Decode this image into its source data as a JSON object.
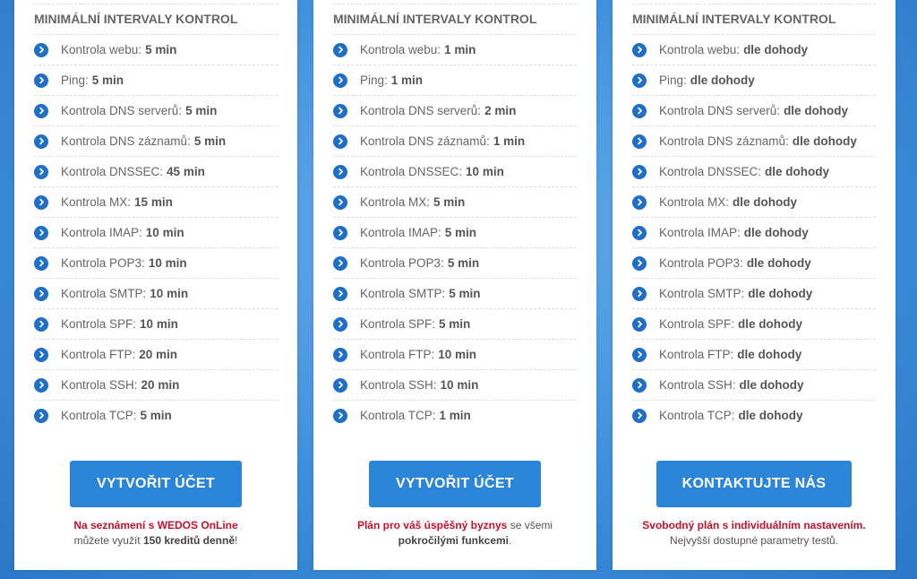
{
  "colors": {
    "accent": "#2b86d9",
    "icon": "#1f6fc9",
    "highlight": "#c8102e"
  },
  "icon_name": "chevron-right-circle-icon",
  "cards": [
    {
      "title": "MINIMÁLNÍ INTERVALY KONTROL",
      "items": [
        {
          "label": "Kontrola webu:",
          "value": "5 min"
        },
        {
          "label": "Ping:",
          "value": "5 min"
        },
        {
          "label": "Kontrola DNS serverů:",
          "value": "5 min"
        },
        {
          "label": "Kontrola DNS záznamů:",
          "value": "5 min"
        },
        {
          "label": "Kontrola DNSSEC:",
          "value": "45 min"
        },
        {
          "label": "Kontrola MX:",
          "value": "15 min"
        },
        {
          "label": "Kontrola IMAP:",
          "value": "10 min"
        },
        {
          "label": "Kontrola POP3:",
          "value": "10 min"
        },
        {
          "label": "Kontrola SMTP:",
          "value": "10 min"
        },
        {
          "label": "Kontrola SPF:",
          "value": "10 min"
        },
        {
          "label": "Kontrola FTP:",
          "value": "20 min"
        },
        {
          "label": "Kontrola SSH:",
          "value": "20 min"
        },
        {
          "label": "Kontrola TCP:",
          "value": "5 min"
        }
      ],
      "button": "VYTVOŘIT ÚČET",
      "note": {
        "line1_red": "Na seznámení s WEDOS OnLine",
        "line2_pre": "můžete využít",
        "line2_bold": "150 kreditů denně",
        "line2_post": "!"
      }
    },
    {
      "title": "MINIMÁLNÍ INTERVALY KONTROL",
      "items": [
        {
          "label": "Kontrola webu:",
          "value": "1 min"
        },
        {
          "label": "Ping:",
          "value": "1 min"
        },
        {
          "label": "Kontrola DNS serverů:",
          "value": "2 min"
        },
        {
          "label": "Kontrola DNS záznamů:",
          "value": "1 min"
        },
        {
          "label": "Kontrola DNSSEC:",
          "value": "10 min"
        },
        {
          "label": "Kontrola MX:",
          "value": "5 min"
        },
        {
          "label": "Kontrola IMAP:",
          "value": "5 min"
        },
        {
          "label": "Kontrola POP3:",
          "value": "5 min"
        },
        {
          "label": "Kontrola SMTP:",
          "value": "5 min"
        },
        {
          "label": "Kontrola SPF:",
          "value": "5 min"
        },
        {
          "label": "Kontrola FTP:",
          "value": "10 min"
        },
        {
          "label": "Kontrola SSH:",
          "value": "10 min"
        },
        {
          "label": "Kontrola TCP:",
          "value": "1 min"
        }
      ],
      "button": "VYTVOŘIT ÚČET",
      "note": {
        "line1_red": "Plán pro váš úspěšný byznys",
        "line1_post": "se všemi",
        "line2_bold": "pokročilými funkcemi",
        "line2_post": "."
      }
    },
    {
      "title": "MINIMÁLNÍ INTERVALY KONTROL",
      "items": [
        {
          "label": "Kontrola webu:",
          "value": "dle dohody"
        },
        {
          "label": "Ping:",
          "value": "dle dohody"
        },
        {
          "label": "Kontrola DNS serverů:",
          "value": "dle dohody"
        },
        {
          "label": "Kontrola DNS záznamů:",
          "value": "dle dohody"
        },
        {
          "label": "Kontrola DNSSEC:",
          "value": "dle dohody"
        },
        {
          "label": "Kontrola MX:",
          "value": "dle dohody"
        },
        {
          "label": "Kontrola IMAP:",
          "value": "dle dohody"
        },
        {
          "label": "Kontrola POP3:",
          "value": "dle dohody"
        },
        {
          "label": "Kontrola SMTP:",
          "value": "dle dohody"
        },
        {
          "label": "Kontrola SPF:",
          "value": "dle dohody"
        },
        {
          "label": "Kontrola FTP:",
          "value": "dle dohody"
        },
        {
          "label": "Kontrola SSH:",
          "value": "dle dohody"
        },
        {
          "label": "Kontrola TCP:",
          "value": "dle dohody"
        }
      ],
      "button": "KONTAKTUJTE NÁS",
      "note": {
        "line1_red": "Svobodný plán s individuálním nastavením.",
        "line2_pre": "Nejvyšší dostupné parametry testů."
      }
    }
  ]
}
